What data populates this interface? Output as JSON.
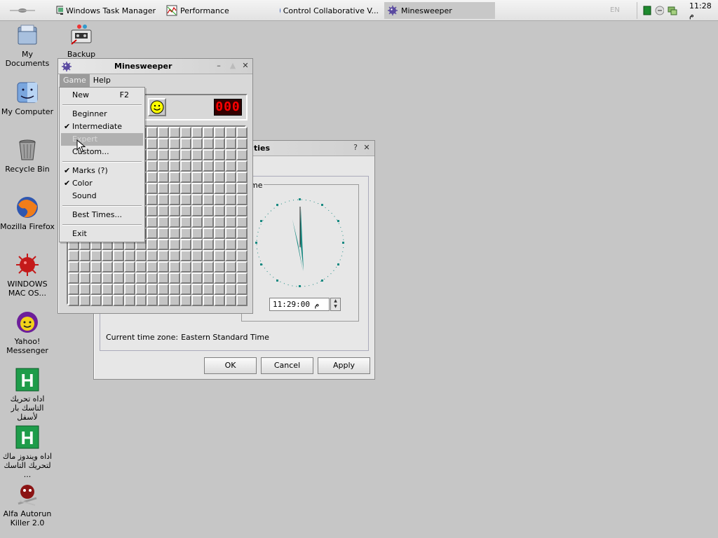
{
  "taskbar": {
    "tasks": [
      {
        "label": "Windows Task Manager",
        "icon": "monitor-icon"
      },
      {
        "label": "Performance",
        "icon": "chart-icon"
      },
      {
        "label": "Control Collaborative V...",
        "icon": "firefox-icon"
      },
      {
        "label": "Minesweeper",
        "icon": "mine-icon",
        "active": true
      }
    ],
    "lang": "EN",
    "clock": "11:28 م"
  },
  "desktop": {
    "icons": [
      {
        "label": "My Documents",
        "icon": "folder-icon"
      },
      {
        "label": "Backup",
        "icon": "backup-icon"
      },
      {
        "label": "My Computer",
        "icon": "mac-finder-icon"
      },
      {
        "label": "Recycle Bin",
        "icon": "trash-icon"
      },
      {
        "label": "Mozilla Firefox",
        "icon": "firefox-icon"
      },
      {
        "label": "WINDOWS MAC OS...",
        "icon": "virus-icon"
      },
      {
        "label": "Yahoo! Messenger",
        "icon": "yahoo-icon"
      },
      {
        "label": "اداه تحريك التاسك بار لأسفل",
        "icon": "h-icon"
      },
      {
        "label": "اداه ويندوز ماك لتحريك التاسك ...",
        "icon": "h-icon"
      },
      {
        "label": "Alfa Autorun Killer 2.0",
        "icon": "alfa-icon"
      }
    ]
  },
  "props_window": {
    "title_fragment": "ties",
    "group_fragment": "me",
    "time_value": "11:29:00 م",
    "timezone_label": "Current time zone:",
    "timezone_value": "Eastern Standard Time",
    "ok": "OK",
    "cancel": "Cancel",
    "apply": "Apply",
    "help_glyph": "?",
    "close_glyph": "✕"
  },
  "minesweeper": {
    "title": "Minesweeper",
    "menu": [
      "Game",
      "Help"
    ],
    "counter_right": "000",
    "grid_rows": 16,
    "grid_cols": 16
  },
  "game_menu": {
    "items": [
      {
        "label": "New",
        "shortcut": "F2"
      },
      {
        "label": "Beginner"
      },
      {
        "label": "Intermediate",
        "checked": true
      },
      {
        "label": "Expert",
        "highlighted": true
      },
      {
        "label": "Custom..."
      },
      {
        "label": "Marks (?)",
        "checked": true
      },
      {
        "label": "Color",
        "checked": true
      },
      {
        "label": "Sound"
      },
      {
        "label": "Best Times..."
      },
      {
        "label": "Exit"
      }
    ],
    "check_glyph": "✔"
  },
  "colors": {
    "accent": "#1a8a82",
    "counter_bg": "#330000",
    "counter_fg": "#ff0000",
    "menu_highlight": "#b0b0b0"
  }
}
